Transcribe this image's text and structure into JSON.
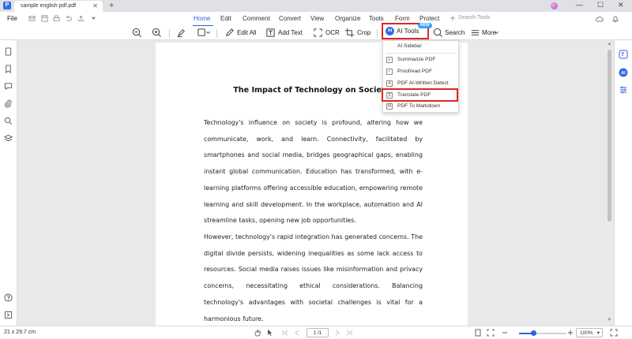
{
  "titlebar": {
    "app_icon_letter": "P",
    "tab_title": "sample english pdf.pdf",
    "close_glyph": "✕",
    "new_tab_glyph": "+",
    "window_controls": [
      "—",
      "☐",
      "✕"
    ]
  },
  "menubar": {
    "file": "File",
    "tabs": [
      "Home",
      "Edit",
      "Comment",
      "Convert",
      "View",
      "Organize",
      "Tools",
      "Form",
      "Protect"
    ],
    "active_tab": "Home",
    "search_placeholder": "Search Tools"
  },
  "toolbar": {
    "edit_all": "Edit All",
    "add_text": "Add Text",
    "ocr": "OCR",
    "crop": "Crop",
    "ai_tools": "AI Tools",
    "ai_icon_text": "AI",
    "new_badge": "NEW",
    "search": "Search",
    "more": "More"
  },
  "ai_menu": {
    "items": [
      {
        "label": "AI Sidebar",
        "icon": "ai-sidebar-icon"
      },
      {
        "label": "Summarize PDF",
        "icon": "summarize-icon"
      },
      {
        "label": "Proofread PDF",
        "icon": "proofread-icon"
      },
      {
        "label": "PDF AI-Written Detect",
        "icon": "ai-detect-icon"
      },
      {
        "label": "Translate PDF",
        "icon": "translate-icon"
      },
      {
        "label": "PDF To Markdown",
        "icon": "markdown-icon"
      }
    ],
    "highlighted": "Translate PDF"
  },
  "document": {
    "title": "The Impact of Technology on Society",
    "paragraph1": "Technology's influence on society is profound, altering how we communicate, work, and learn. Connectivity, facilitated by smartphones and social media, bridges geographical gaps, enabling instant global communication. Education has transformed, with e-learning platforms offering accessible education, empowering remote learning and skill development. In the workplace, automation and AI streamline tasks, opening new job opportunities.",
    "paragraph2": "However, technology's rapid integration has generated concerns. The digital divide persists, widening inequalities as some lack access to resources. Social media raises issues like misinformation and privacy concerns, necessitating ethical considerations. Balancing technology's advantages with societal challenges is vital for a harmonious future."
  },
  "statusbar": {
    "page_size": "21 x 29.7 cm",
    "page_indicator": "1 /1",
    "zoom": "100%",
    "zoom_level": 0.3
  },
  "colors": {
    "accent": "#2b63e0",
    "highlight_border": "#e32426",
    "page_background": "#e9e9ec"
  }
}
